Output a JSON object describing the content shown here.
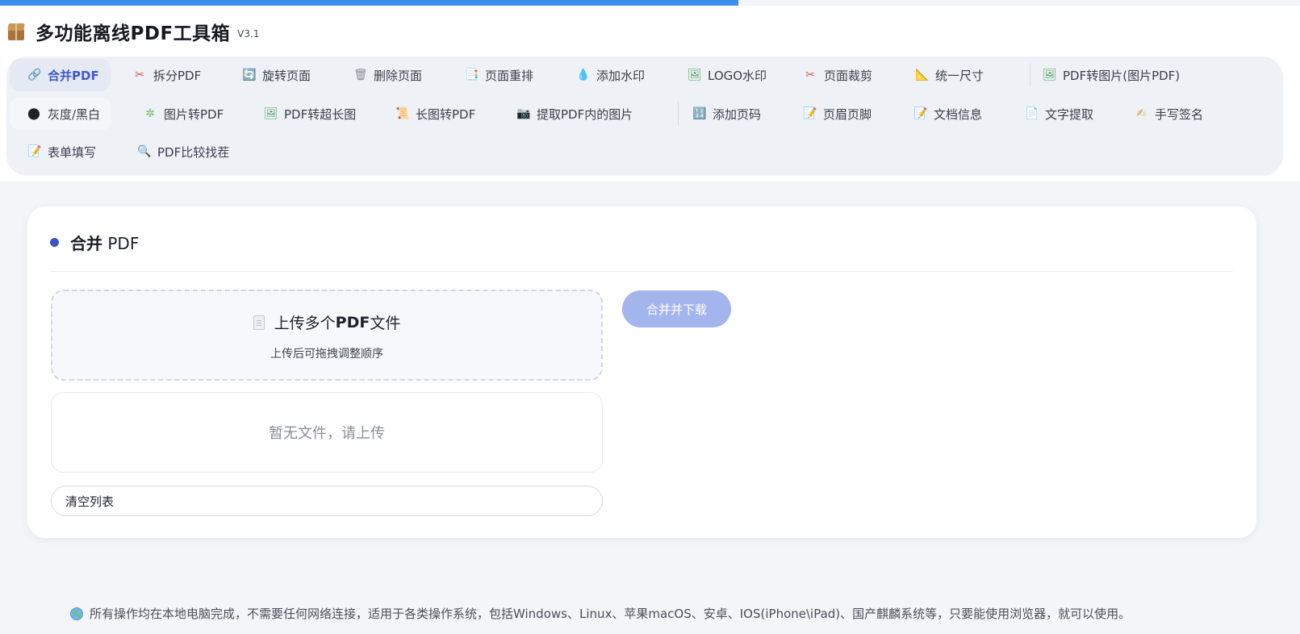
{
  "app": {
    "title": "多功能离线PDF工具箱",
    "version": "V3.1"
  },
  "toolbar": {
    "tools": [
      {
        "label": "合并PDF",
        "icon": "link-icon"
      },
      {
        "label": "拆分PDF",
        "icon": "scissors-icon"
      },
      {
        "label": "旋转页面",
        "icon": "rotate-icon"
      },
      {
        "label": "删除页面",
        "icon": "trash-icon"
      },
      {
        "label": "页面重排",
        "icon": "reorder-icon"
      },
      {
        "label": "添加水印",
        "icon": "droplet-icon"
      },
      {
        "label": "LOGO水印",
        "icon": "picture-icon"
      },
      {
        "label": "页面裁剪",
        "icon": "scissors-icon"
      },
      {
        "label": "统一尺寸",
        "icon": "ruler-icon"
      },
      {
        "label": "PDF转图片(图片PDF)",
        "icon": "picture-icon"
      },
      {
        "label": "灰度/黑白",
        "icon": "black-circle-icon"
      },
      {
        "label": "图片转PDF",
        "icon": "puzzle-icon"
      },
      {
        "label": "PDF转超长图",
        "icon": "picture-icon"
      },
      {
        "label": "长图转PDF",
        "icon": "scroll-icon"
      },
      {
        "label": "提取PDF内的图片",
        "icon": "camera-icon"
      },
      {
        "label": "添加页码",
        "icon": "numbers-icon"
      },
      {
        "label": "页眉页脚",
        "icon": "memo-icon"
      },
      {
        "label": "文档信息",
        "icon": "memo-icon"
      },
      {
        "label": "文字提取",
        "icon": "document-icon"
      },
      {
        "label": "手写签名",
        "icon": "writing-hand-icon"
      },
      {
        "label": "表单填写",
        "icon": "memo-icon"
      },
      {
        "label": "PDF比较找茬",
        "icon": "magnifier-icon"
      }
    ],
    "active_index": 0
  },
  "merge_card": {
    "title_bold": "合并",
    "title_rest": " PDF",
    "upload": {
      "main_text_a": "上传多个 ",
      "main_text_b": "PDF",
      "main_text_c": " 文件",
      "sub_text": "上传后可拖拽调整顺序"
    },
    "merge_button": "合并并下载",
    "empty_list_text": "暂无文件，请上传",
    "clear_button": "清空列表"
  },
  "footer": {
    "text": "所有操作均在本地电脑完成，不需要任何网络连接，适用于各类操作系统，包括Windows、Linux、苹果macOS、安卓、IOS(iPhone\\iPad)、国产麒麟系统等，只要能使用浏览器，就可以使用。"
  },
  "colors": {
    "accent": "#3f59c7",
    "merge_button_bg": "#a4b5ee",
    "progress_bar": "#3b8df0",
    "page_bg": "#f3f5f8"
  }
}
